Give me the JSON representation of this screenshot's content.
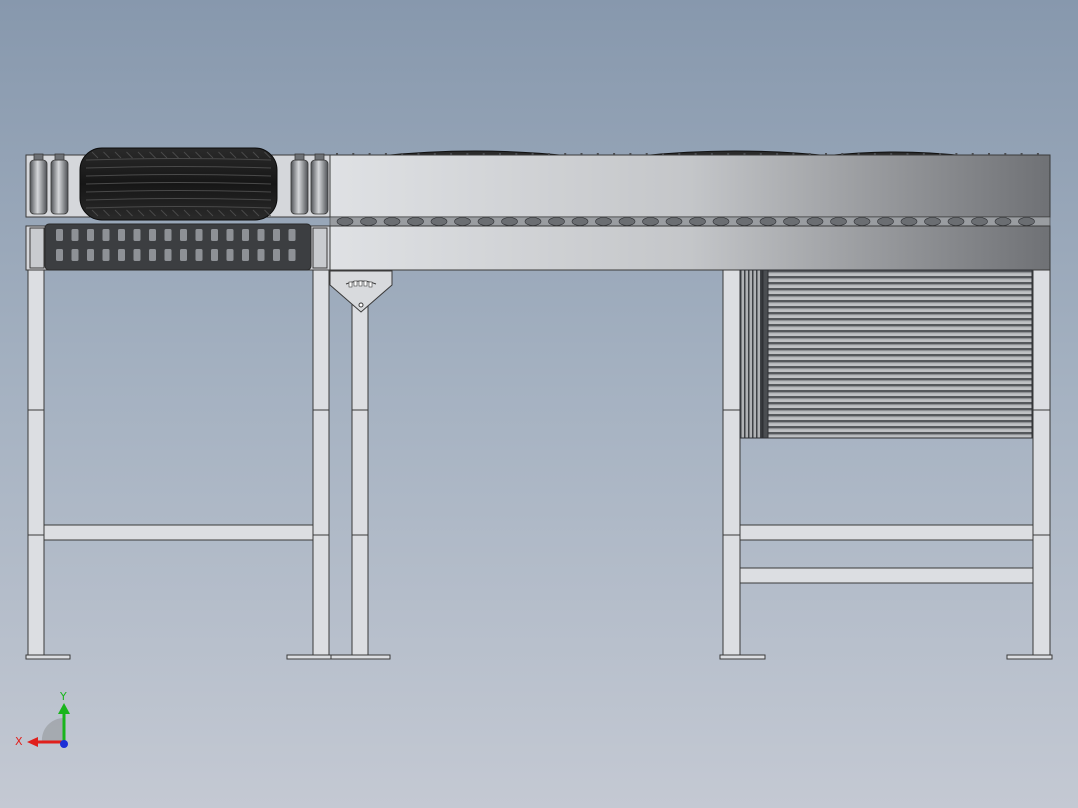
{
  "viewport": {
    "background_top": "#8798ad",
    "background_bottom": "#c4c9d3"
  },
  "model": {
    "frame_color": "#d9dbe0",
    "edge_color": "#3a3a3a",
    "tire_color": "#1c1c1c",
    "roller_color": "#8a8d92"
  },
  "triad": {
    "x_label": "X",
    "y_label": "Y",
    "x_color": "#e0201c",
    "y_color": "#19b51c",
    "z_color": "#1d2fd6"
  }
}
